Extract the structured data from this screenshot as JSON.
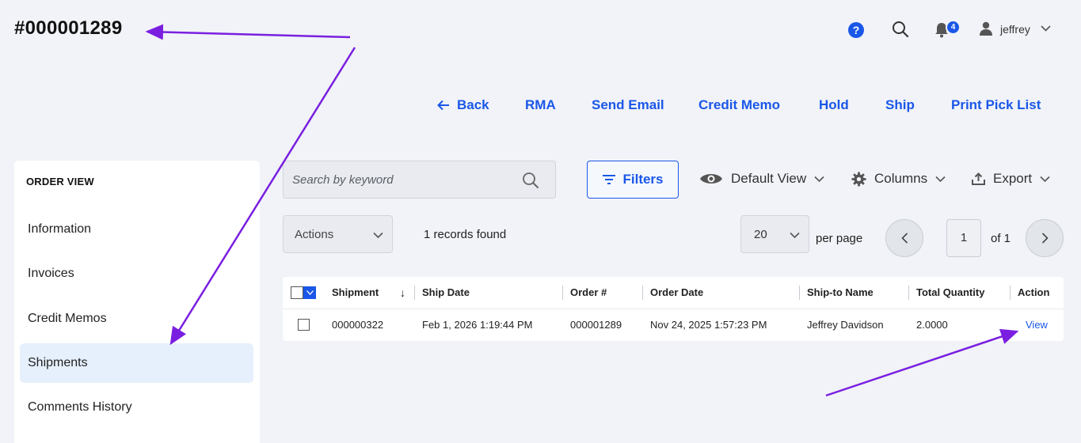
{
  "header": {
    "order_title": "#000001289",
    "help_glyph": "?",
    "notifications_count": "4",
    "user_name": "jeffrey"
  },
  "action_links": [
    {
      "label": "Back"
    },
    {
      "label": "RMA"
    },
    {
      "label": "Send Email"
    },
    {
      "label": "Credit Memo"
    },
    {
      "label": "Hold"
    },
    {
      "label": "Ship"
    },
    {
      "label": "Print Pick List"
    }
  ],
  "sidebar": {
    "title": "ORDER VIEW",
    "items": [
      {
        "label": "Information",
        "active": false
      },
      {
        "label": "Invoices",
        "active": false
      },
      {
        "label": "Credit Memos",
        "active": false
      },
      {
        "label": "Shipments",
        "active": true
      },
      {
        "label": "Comments History",
        "active": false
      }
    ]
  },
  "toolbar": {
    "search_placeholder": "Search by keyword",
    "filters_label": "Filters",
    "view_label": "Default View",
    "columns_label": "Columns",
    "export_label": "Export"
  },
  "listing": {
    "actions_label": "Actions",
    "records_found": "1 records found",
    "per_page_value": "20",
    "per_page_label": "per page",
    "current_page": "1",
    "page_of": "of 1"
  },
  "table": {
    "columns": [
      "Shipment",
      "Ship Date",
      "Order #",
      "Order Date",
      "Ship-to Name",
      "Total Quantity",
      "Action"
    ],
    "sort_indicator": "↓",
    "rows": [
      [
        "000000322",
        "Feb 1, 2026 1:19:44 PM",
        "000001289",
        "Nov 24, 2025 1:57:23 PM",
        "Jeffrey Davidson",
        "2.0000",
        "View"
      ]
    ]
  },
  "colors": {
    "accent": "#1a57e8",
    "annotation": "#7a1fe0",
    "background": "#f1f3f8",
    "active_item": "#e6effc"
  }
}
